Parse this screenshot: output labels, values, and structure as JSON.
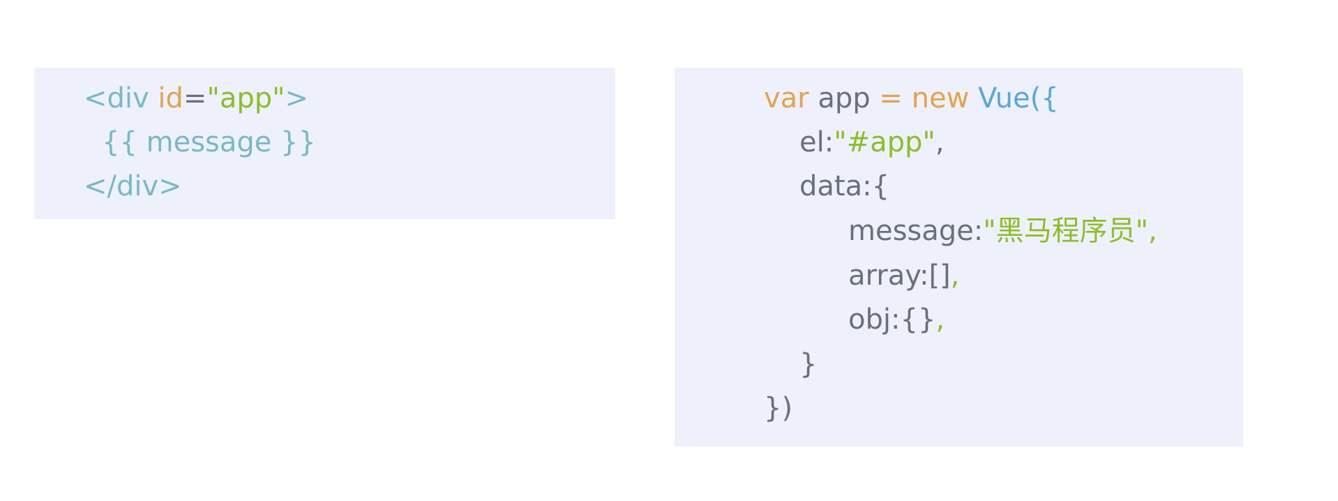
{
  "html_snippet": {
    "open_tag_start": "<div ",
    "attr_name": "id",
    "attr_eq": "=",
    "attr_value": "\"app\"",
    "open_tag_end": ">",
    "interpolation": "{{ message }}",
    "close_tag": "</div>"
  },
  "js_snippet": {
    "line1": {
      "var": "var",
      "name": " app ",
      "eq": "=",
      "new": " new ",
      "class": "Vue",
      "paren": "({"
    },
    "line2": {
      "key": "el:",
      "value": "\"#app\"",
      "comma": ","
    },
    "line3": {
      "text": "data:{"
    },
    "line4": {
      "key": "message:",
      "value": "\"黑马程序员\"",
      "comma": ","
    },
    "line5": {
      "key": "array:[]",
      "comma": ","
    },
    "line6": {
      "key": "obj:{}",
      "comma": ","
    },
    "line7": {
      "text": "}"
    },
    "line8": {
      "text": "})"
    }
  },
  "colors": {
    "box_background": "#eef1fb",
    "tag": "#7ab8c6",
    "attribute": "#e0a452",
    "string": "#8dbd2b",
    "keyword": "#e0a452",
    "class_name": "#5aa6d9",
    "plain": "#6b6f77"
  }
}
